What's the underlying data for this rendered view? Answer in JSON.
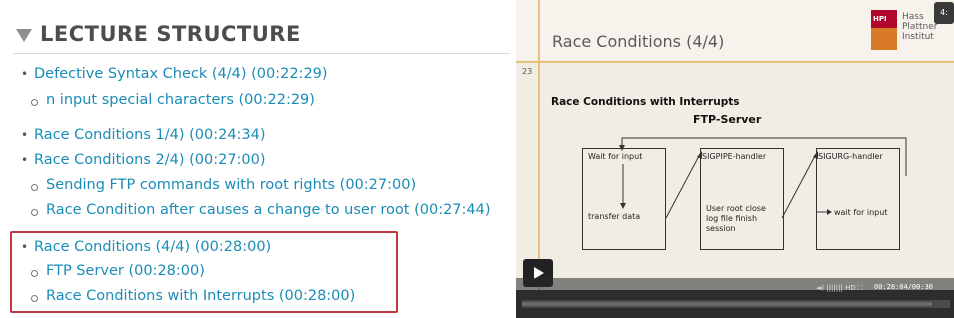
{
  "lecture_structure": {
    "title": "LECTURE STRUCTURE",
    "items": [
      {
        "level": 1,
        "label": "Defective Syntax Check (4/4) (00:22:29)"
      },
      {
        "level": 2,
        "label": "n input special characters (00:22:29)"
      },
      {
        "level": 1,
        "label": "Race Conditions 1/4) (00:24:34)"
      },
      {
        "level": 1,
        "label": "Race Conditions 2/4) (00:27:00)"
      },
      {
        "level": 2,
        "label": "Sending FTP commands with root rights (00:27:00)"
      },
      {
        "level": 2,
        "label": "Race Condition after causes a change to user root (00:27:44)"
      },
      {
        "level": 1,
        "label": "Race Conditions (4/4) (00:28:00)"
      },
      {
        "level": 2,
        "label": "FTP Server (00:28:00)"
      },
      {
        "level": 2,
        "label": "Race Conditions with Interrupts (00:28:00)"
      }
    ]
  },
  "video": {
    "slide_title": "Race Conditions  (4/4)",
    "slide_number": "23",
    "logo_abbrev": "HPI",
    "logo_name_lines": [
      "Hass",
      "Plattner",
      "Institut"
    ],
    "corner_badge": "4:",
    "heading": "Race Conditions with Interrupts",
    "subheading": "FTP-Server",
    "boxes": {
      "box1_top": "Wait for input",
      "box1_bottom": "transfer data",
      "box2_top": "SIGPIPE-handler",
      "box2_bottom": "User root close log file finish session",
      "box3_top": "SIGURG-handler",
      "box3_bottom": "wait for input"
    },
    "controls": {
      "quality": "HD",
      "time": "00:28:04/00:30"
    }
  },
  "colors": {
    "link": "#1a8cb7",
    "highlight_border": "#c0393b",
    "slide_accent": "#e4c27c",
    "hpi_red": "#b0062c"
  }
}
